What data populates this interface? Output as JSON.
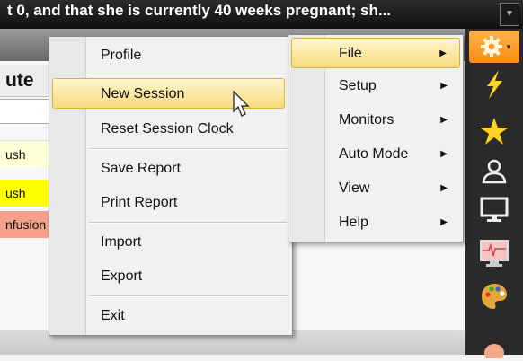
{
  "banner": {
    "text": "t 0, and that she is currently 40 weeks pregnant; sh...",
    "dropdown_glyph": "▼"
  },
  "background": {
    "column_title": "ute",
    "cells": [
      "ush",
      "ush",
      "nfusion"
    ]
  },
  "context_menu": {
    "items": [
      {
        "label": "Profile"
      },
      {
        "label": "New Session",
        "highlighted": true
      },
      {
        "label": "Reset Session Clock"
      },
      {
        "label": "Save Report"
      },
      {
        "label": "Print Report"
      },
      {
        "label": "Import"
      },
      {
        "label": "Export"
      },
      {
        "label": "Exit"
      }
    ]
  },
  "main_menu": {
    "items": [
      {
        "label": "File",
        "highlighted": true
      },
      {
        "label": "Setup"
      },
      {
        "label": "Monitors"
      },
      {
        "label": "Auto Mode"
      },
      {
        "label": "View"
      },
      {
        "label": "Help"
      }
    ],
    "submenu_arrow": "▶"
  },
  "toolbar": {
    "icons": [
      "gear-icon",
      "lightning-icon",
      "star-icon",
      "user-icon",
      "monitor-icon",
      "ecg-monitor-icon",
      "palette-icon",
      "hand-icon"
    ]
  },
  "colors": {
    "highlight_top": "#fff6cf",
    "highlight_bottom": "#f6da7c",
    "toolbar_bg": "#2a2a2a",
    "star": "#ffd21f"
  }
}
